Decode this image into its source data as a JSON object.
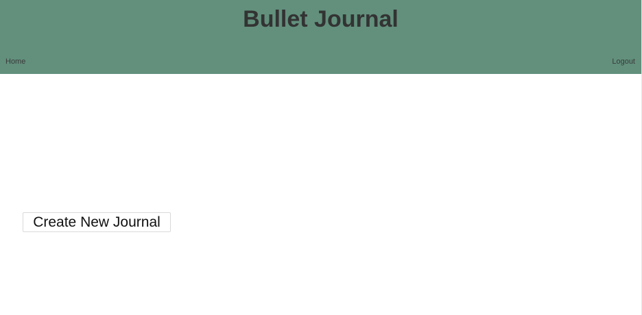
{
  "header": {
    "title": "Bullet Journal",
    "background_color": "#62907d",
    "nav": {
      "home_label": "Home",
      "logout_label": "Logout"
    }
  },
  "main": {
    "create_button_label": "Create New Journal"
  }
}
